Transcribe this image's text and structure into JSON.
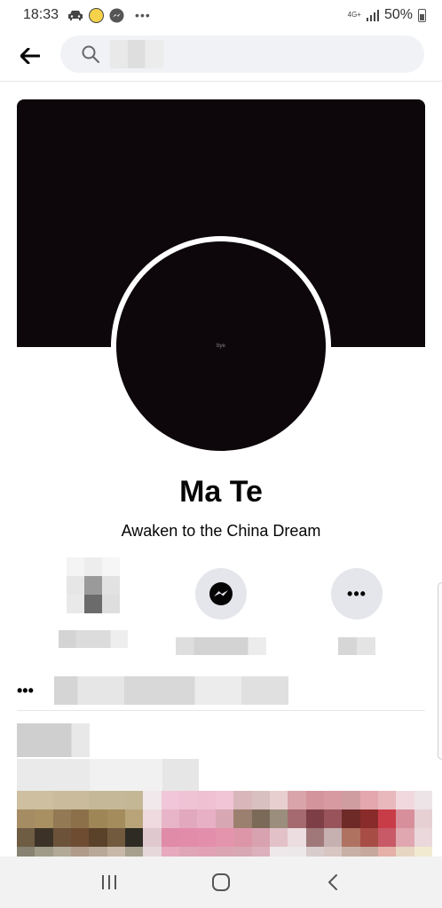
{
  "status_bar": {
    "time": "18:33",
    "network": "4G+",
    "battery": "50%",
    "more": "•••"
  },
  "search": {
    "placeholder": "",
    "icon": "search-icon"
  },
  "profile": {
    "name": "Ma Te",
    "bio": "Awaken to the China Dream",
    "avatar_text": "bye"
  },
  "actions": {
    "friend": {
      "icon": "add-friend-icon",
      "label": ""
    },
    "message": {
      "icon": "messenger-icon",
      "label": ""
    },
    "more": {
      "icon": "more-icon",
      "symbol": "•••",
      "label": ""
    }
  },
  "details": {
    "dots": "•••",
    "text": ""
  },
  "post": {
    "author": "",
    "meta": ""
  },
  "colors": {
    "cover": "#0d060a",
    "button_bg": "#e4e6eb",
    "text": "#050505"
  },
  "nav": {
    "recent": "recent-apps-icon",
    "home": "home-icon",
    "back": "back-icon"
  }
}
